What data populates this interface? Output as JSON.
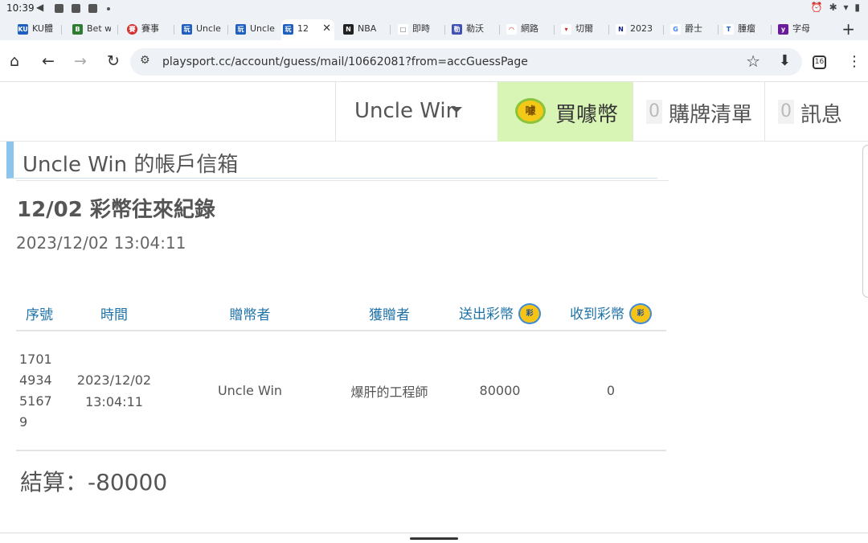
{
  "status": {
    "time": "10:39"
  },
  "tabs": [
    {
      "label": "KU體",
      "fav": "KU",
      "color": "#1e5fbf"
    },
    {
      "label": "Bet w",
      "fav": "B",
      "color": "#2e7d32"
    },
    {
      "label": "賽事",
      "fav": "賽",
      "color": "#d32f2f"
    },
    {
      "label": "Uncle",
      "fav": "玩",
      "color": "#1e5fbf"
    },
    {
      "label": "Uncle",
      "fav": "玩",
      "color": "#1e5fbf"
    },
    {
      "label": "12",
      "fav": "玩",
      "color": "#1e5fbf"
    },
    {
      "label": "NBA",
      "fav": "N",
      "color": "#222222"
    },
    {
      "label": "即時",
      "fav": "□",
      "color": "#888888"
    },
    {
      "label": "勒沃",
      "fav": "勒",
      "color": "#3f51b5"
    },
    {
      "label": "網路",
      "fav": "◠",
      "color": "#c62828"
    },
    {
      "label": "切爾",
      "fav": "▾",
      "color": "#c62828"
    },
    {
      "label": "2023",
      "fav": "N",
      "color": "#1a237e"
    },
    {
      "label": "爵士",
      "fav": "G",
      "color": "#4285f4"
    },
    {
      "label": "腫瘤",
      "fav": "T",
      "color": "#1565c0"
    },
    {
      "label": "字母",
      "fav": "y",
      "color": "#6a1b9a"
    }
  ],
  "address": {
    "url": "playsport.cc/account/guess/mail/10662081?from=accGuessPage",
    "tab_count": "16"
  },
  "header": {
    "username": "Uncle Win",
    "buy_coin": "買噱幣",
    "coin_icon_text": "噱",
    "cart_count": "0",
    "cart_label": "購牌清單",
    "msg_count": "0",
    "msg_label": "訊息"
  },
  "page": {
    "title": "Uncle Win 的帳戶信箱",
    "subject": "12/02 彩幣往來紀錄",
    "date": "2023/12/02 13:04:11",
    "summary": "結算：-80000"
  },
  "table": {
    "coin_icon_text": "彩",
    "headers": [
      "序號",
      "時間",
      "贈幣者",
      "獲贈者",
      "送出彩幣",
      "收到彩幣"
    ],
    "row": {
      "id_lines": [
        "1701",
        "4934",
        "5167",
        "9"
      ],
      "time_lines": [
        "2023/12/02",
        "13:04:11"
      ],
      "giver": "Uncle Win",
      "receiver": "爆肝的工程師",
      "sent": "80000",
      "received": "0"
    }
  }
}
